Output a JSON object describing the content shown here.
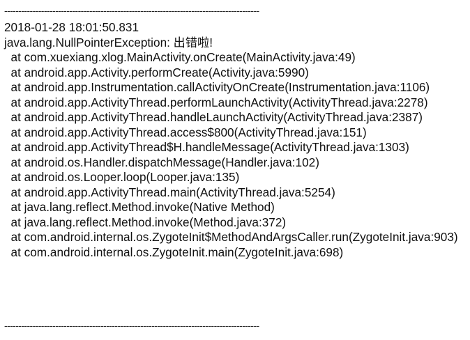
{
  "log": {
    "separator": "------------------------------------------------------------------------------------------",
    "timestamp": "2018-01-28 18:01:50.831",
    "exception": "java.lang.NullPointerException: 出错啦!",
    "frames": [
      "  at com.xuexiang.xlog.MainActivity.onCreate(MainActivity.java:49)",
      "  at android.app.Activity.performCreate(Activity.java:5990)",
      "  at android.app.Instrumentation.callActivityOnCreate(Instrumentation.java:1106)",
      "  at android.app.ActivityThread.performLaunchActivity(ActivityThread.java:2278)",
      "  at android.app.ActivityThread.handleLaunchActivity(ActivityThread.java:2387)",
      "  at android.app.ActivityThread.access$800(ActivityThread.java:151)",
      "  at android.app.ActivityThread$H.handleMessage(ActivityThread.java:1303)",
      "  at android.os.Handler.dispatchMessage(Handler.java:102)",
      "  at android.os.Looper.loop(Looper.java:135)",
      "  at android.app.ActivityThread.main(ActivityThread.java:5254)",
      "  at java.lang.reflect.Method.invoke(Native Method)",
      "  at java.lang.reflect.Method.invoke(Method.java:372)",
      "  at com.android.internal.os.ZygoteInit$MethodAndArgsCaller.run(ZygoteInit.java:903)",
      "  at com.android.internal.os.ZygoteInit.main(ZygoteInit.java:698)"
    ]
  }
}
